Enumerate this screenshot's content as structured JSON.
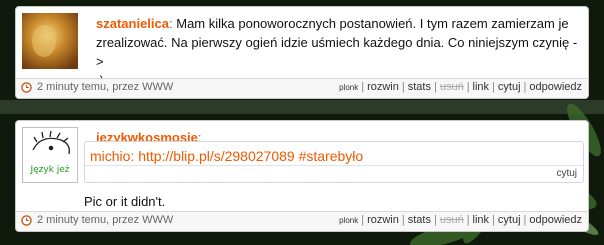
{
  "posts": [
    {
      "author": "szatanielica",
      "colon": ":",
      "text_line1": "Mam kilka ponoworocznych postanowień. I tym razem zamierzam je",
      "text_line2": "zrealizować. Na pierwszy ogień idzie uśmiech każdego dnia. Co niniejszym czynię ->",
      "text_line3": ":)",
      "time": "2 minuty temu, przez WWW",
      "actions": {
        "plonk": "plonk",
        "expand": "rozwin",
        "stats": "stats",
        "delete": "usuń",
        "link": "link",
        "quote": "cytuj",
        "reply": "odpowiedz"
      }
    },
    {
      "author": "jezykwkosmosie",
      "colon": ":",
      "avatar_text": "Język jeż",
      "quote_text": "michio: http://blip.pl/s/298027089 #starebyło",
      "quote_reply": "cytuj",
      "text": "Pic or it didn't.",
      "time": "2 minuty temu, przez WWW",
      "actions": {
        "plonk": "plonk",
        "expand": "rozwin",
        "stats": "stats",
        "delete": "usuń",
        "link": "link",
        "quote": "cytuj",
        "reply": "odpowiedz"
      }
    }
  ]
}
